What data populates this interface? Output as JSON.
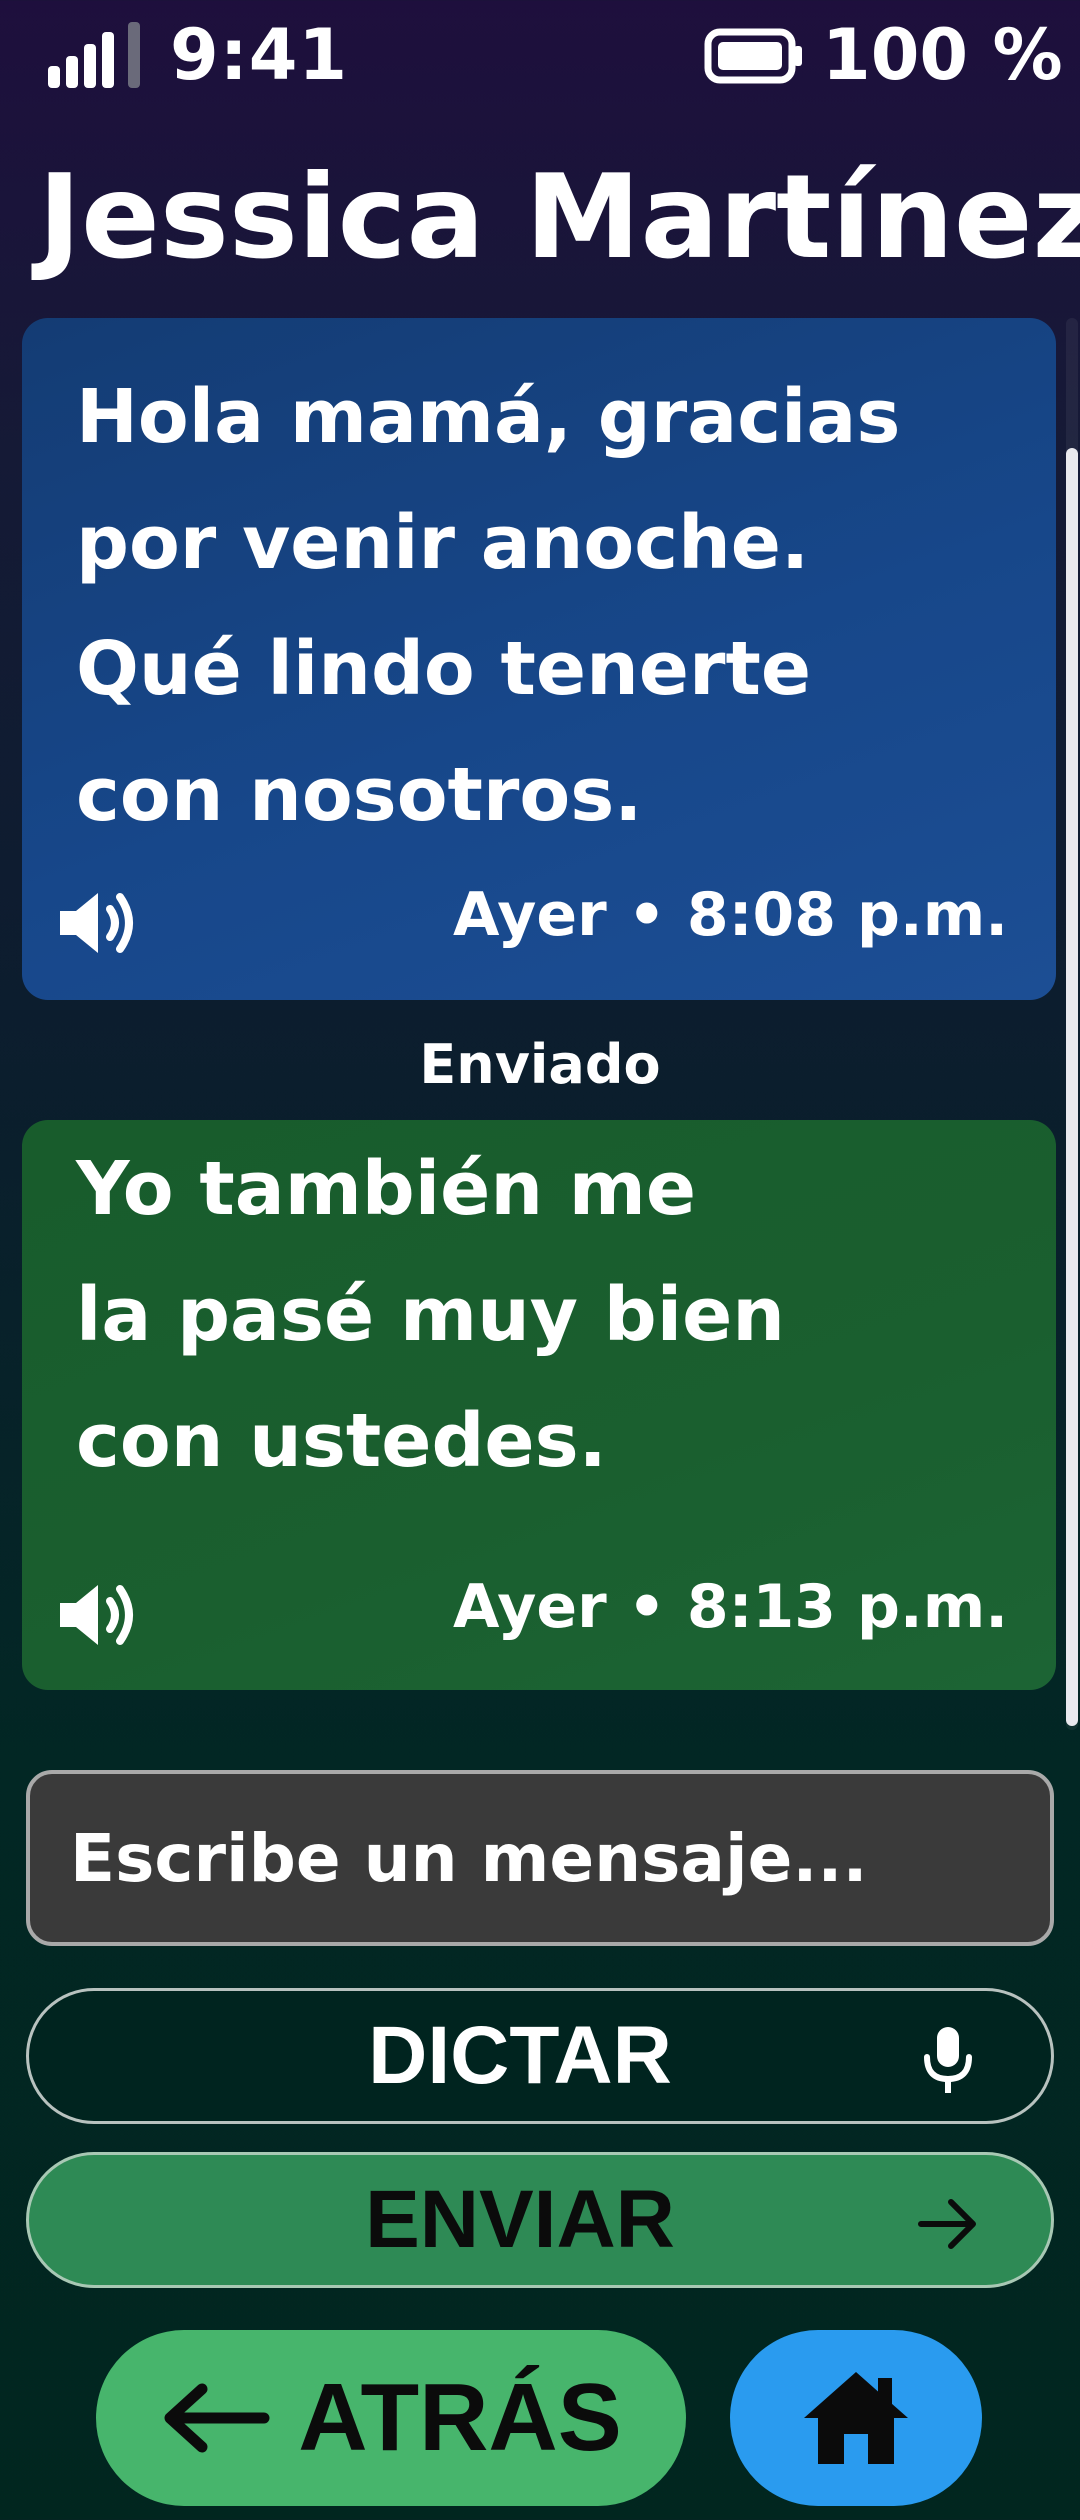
{
  "status_bar": {
    "time": "9:41",
    "battery_text": "100 %",
    "signal_icon": "signal-bars-icon",
    "battery_icon": "battery-full-icon"
  },
  "header": {
    "title": "Jessica Martínez"
  },
  "messages": [
    {
      "direction": "received",
      "text": "Hola mamá, gracias\npor venir anoche.\nQué lindo tenerte\ncon nosotros.",
      "time": "Ayer • 8:08 p.m.",
      "icon": "speaker-icon",
      "color": "#17478a"
    },
    {
      "direction": "sent",
      "status_label": "Enviado",
      "text": "Yo también me\nla pasé muy bien\ncon ustedes.",
      "time": "Ayer • 8:13 p.m.",
      "icon": "speaker-icon",
      "color": "#1a5f2f"
    }
  ],
  "composer": {
    "placeholder": "Escribe un mensaje...",
    "value": ""
  },
  "actions": {
    "dictate_label": "DICTAR",
    "dictate_icon": "microphone-icon",
    "send_label": "ENVIAR",
    "send_icon": "arrow-right-icon",
    "back_label": "ATRÁS",
    "back_icon": "arrow-left-icon",
    "home_icon": "home-icon"
  },
  "colors": {
    "send_button": "#2e8a55",
    "back_button": "#47b56c",
    "home_button": "#2a9bef",
    "input_background": "#3a3a3a"
  }
}
